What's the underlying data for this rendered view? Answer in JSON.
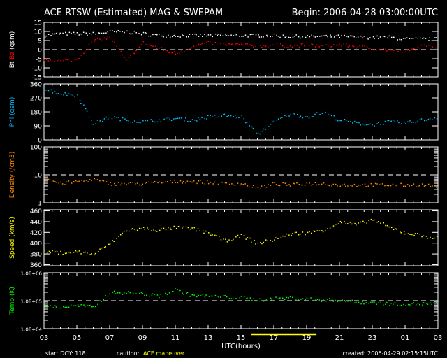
{
  "title": "ACE RTSW (Estimated) MAG & SWEPAM",
  "begin": "Begin: 2006-04-28 03:00:00UTC",
  "footer": {
    "start_doy": "start DOY: 118",
    "caution_label": "caution:",
    "caution_value": "ACE maneuver",
    "created": "created: 2006-04-29 02:15:15UTC"
  },
  "colors": {
    "bt": "#ffffff",
    "bz": "#ff0000",
    "phi": "#00bfff",
    "density": "#ff8c00",
    "speed": "#ffff00",
    "temp": "#00ff00",
    "caution": "#ffff00"
  },
  "chart_data": {
    "type": "scatter",
    "xlabel": "UTC(hours)",
    "x_tick_labels": [
      "03",
      "05",
      "07",
      "09",
      "11",
      "13",
      "15",
      "17",
      "19",
      "21",
      "23",
      "01",
      "03"
    ],
    "x_range_hours": [
      0,
      24
    ],
    "x_hours": [
      0,
      1,
      2,
      3,
      4,
      5,
      6,
      7,
      8,
      9,
      10,
      11,
      12,
      13,
      14,
      15,
      16,
      17,
      18,
      19,
      20,
      21,
      22,
      23,
      24
    ],
    "highlight_interval_hours": [
      12.6,
      16.6
    ],
    "panels": [
      {
        "id": "mag",
        "ylabel_parts": [
          "Bt",
          "Bz",
          "(gsm)"
        ],
        "scale": "linear",
        "ylim": [
          -15,
          15
        ],
        "ticks": [
          "15",
          "10",
          "5",
          "0",
          "-5",
          "-10",
          "-15"
        ],
        "tick_values": [
          15,
          10,
          5,
          0,
          -5,
          -10,
          -15
        ],
        "dashed": 0,
        "series": [
          {
            "name": "Bt",
            "color": "#ffffff",
            "values": [
              8,
              9,
              9,
              9,
              10,
              10,
              9,
              8,
              8,
              8,
              8,
              8,
              8,
              8,
              8,
              7.5,
              7.5,
              7.5,
              7.5,
              7,
              7,
              7,
              6,
              6,
              6
            ]
          },
          {
            "name": "Bz",
            "color": "#ff0000",
            "values": [
              -5,
              -6,
              -5,
              5,
              7,
              -6,
              4,
              1,
              -2,
              2,
              4,
              3,
              3,
              2,
              3,
              2,
              3,
              2,
              3,
              2,
              1,
              0,
              -1,
              2,
              2
            ]
          }
        ]
      },
      {
        "id": "phi",
        "ylabel_parts": [
          "Phi (gsm)"
        ],
        "scale": "linear",
        "ylim": [
          0,
          360
        ],
        "ticks": [
          "360",
          "270",
          "180",
          "90",
          "0"
        ],
        "tick_values": [
          360,
          270,
          180,
          90,
          0
        ],
        "series": [
          {
            "name": "Phi",
            "color": "#00bfff",
            "values": [
              330,
              300,
              290,
              110,
              150,
              130,
              120,
              130,
              140,
              130,
              150,
              160,
              150,
              40,
              120,
              170,
              150,
              180,
              130,
              110,
              100,
              120,
              110,
              130,
              150
            ]
          }
        ]
      },
      {
        "id": "density",
        "ylabel_parts": [
          "Density (/cm3)"
        ],
        "scale": "log",
        "ylim": [
          1,
          100
        ],
        "ticks": [
          "100",
          "10",
          "1"
        ],
        "tick_values": [
          100,
          10,
          1
        ],
        "dashed": 10,
        "series": [
          {
            "name": "Density",
            "color": "#ff8c00",
            "values": [
              8,
              5,
              6,
              7,
              5,
              5,
              5,
              5.5,
              6,
              6,
              5.5,
              5,
              5,
              3.5,
              5,
              4.5,
              5,
              5,
              4.5,
              4.5,
              4.5,
              4.5,
              4.5,
              4.5,
              4
            ]
          }
        ]
      },
      {
        "id": "speed",
        "ylabel_parts": [
          "Speed (km/s)"
        ],
        "scale": "linear",
        "ylim": [
          358,
          462
        ],
        "ticks": [
          "460",
          "440",
          "420",
          "400",
          "380",
          "360"
        ],
        "tick_values": [
          460,
          440,
          420,
          400,
          380,
          360
        ],
        "series": [
          {
            "name": "Speed",
            "color": "#ffff00",
            "values": [
              385,
              383,
              385,
              380,
              400,
              425,
              428,
              425,
              430,
              428,
              420,
              405,
              415,
              400,
              408,
              418,
              420,
              425,
              440,
              435,
              445,
              430,
              420,
              415,
              410
            ]
          }
        ]
      },
      {
        "id": "temp",
        "ylabel_parts": [
          "Temp (K)"
        ],
        "scale": "log",
        "ylim": [
          10000,
          1000000
        ],
        "ticks": [
          "1.0E+06",
          "1.0E+05",
          "1.0E+04"
        ],
        "tick_values": [
          1000000,
          100000,
          10000
        ],
        "dashed": 100000,
        "series": [
          {
            "name": "Temp",
            "color": "#00ff00",
            "values": [
              70000,
              60000,
              70000,
              60000,
              200000,
              200000,
              180000,
              150000,
              250000,
              160000,
              150000,
              140000,
              130000,
              110000,
              120000,
              130000,
              120000,
              110000,
              110000,
              90000,
              90000,
              80000,
              80000,
              80000,
              80000
            ]
          }
        ]
      }
    ]
  }
}
